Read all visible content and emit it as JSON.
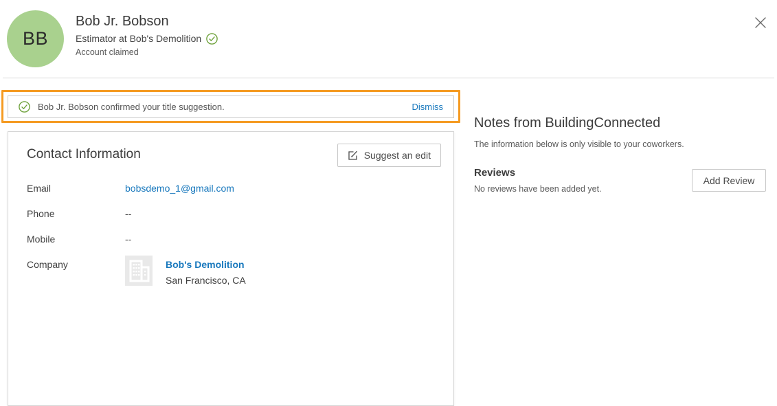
{
  "header": {
    "avatar_initials": "BB",
    "name": "Bob Jr. Bobson",
    "title": "Estimator at Bob's Demolition",
    "account_status": "Account claimed"
  },
  "notification": {
    "message": "Bob Jr. Bobson confirmed your title suggestion.",
    "dismiss_label": "Dismiss"
  },
  "contact": {
    "heading": "Contact Information",
    "suggest_edit_label": "Suggest an edit",
    "fields": [
      {
        "label": "Email",
        "value": "bobsdemo_1@gmail.com"
      },
      {
        "label": "Phone",
        "value": "--"
      },
      {
        "label": "Mobile",
        "value": "--"
      }
    ],
    "company_label": "Company",
    "company": {
      "name": "Bob's Demolition",
      "location": "San Francisco, CA"
    }
  },
  "notes": {
    "heading": "Notes from BuildingConnected",
    "subtitle": "The information below is only visible to your coworkers.",
    "reviews_heading": "Reviews",
    "reviews_empty": "No reviews have been added yet.",
    "add_review_label": "Add Review"
  },
  "icons": {
    "check_circle": "✓",
    "close": "✕",
    "edit": "✎",
    "building": "🏢"
  },
  "colors": {
    "avatar_green": "#a9d18e",
    "check_green": "#6fa23c",
    "link_blue": "#1878bd",
    "highlight_orange": "#f59b23",
    "border_gray": "#d6d6d6"
  }
}
